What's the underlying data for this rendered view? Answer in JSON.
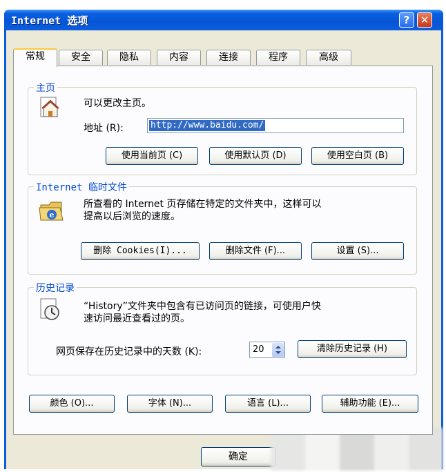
{
  "window": {
    "title": "Internet 选项",
    "help_label": "?",
    "close_label": "✕"
  },
  "tabs": [
    {
      "label": "常规",
      "active": true
    },
    {
      "label": "安全",
      "active": false
    },
    {
      "label": "隐私",
      "active": false
    },
    {
      "label": "内容",
      "active": false
    },
    {
      "label": "连接",
      "active": false
    },
    {
      "label": "程序",
      "active": false
    },
    {
      "label": "高级",
      "active": false
    }
  ],
  "home": {
    "title": "主页",
    "desc": "可以更改主页。",
    "address_label": "地址 (R):",
    "address_value": "http://www.baidu.com/",
    "btn_current": "使用当前页 (C)",
    "btn_default": "使用默认页 (D)",
    "btn_blank": "使用空白页 (B)"
  },
  "temp": {
    "title": "Internet 临时文件",
    "desc_line1": "所查看的 Internet 页存储在特定的文件夹中，这样可以",
    "desc_line2": "提高以后浏览的速度。",
    "btn_cookies": "删除 Cookies(I)...",
    "btn_files": "删除文件 (F)...",
    "btn_settings": "设置 (S)..."
  },
  "history": {
    "title": "历史记录",
    "desc_line1": "“History”文件夹中包含有已访问页的链接，可使用户快",
    "desc_line2": "速访问最近查看过的页。",
    "days_label": "网页保存在历史记录中的天数 (K):",
    "days_value": "20",
    "btn_clear": "清除历史记录 (H)"
  },
  "bottom": {
    "btn_colors": "颜色 (O)...",
    "btn_fonts": "字体 (N)...",
    "btn_languages": "语言 (L)...",
    "btn_accessibility": "辅助功能 (E)..."
  },
  "footer": {
    "btn_ok": "确定"
  }
}
